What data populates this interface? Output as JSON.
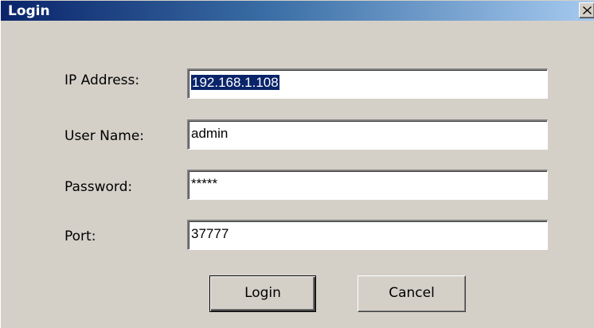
{
  "window": {
    "title": "Login",
    "close_label": "×"
  },
  "form": {
    "ip_label": "IP Address:",
    "ip_value": "192.168.1.108",
    "user_label": "User Name:",
    "user_value": "admin",
    "password_label": "Password:",
    "password_value": "*****",
    "port_label": "Port:",
    "port_value": "37777"
  },
  "buttons": {
    "login": "Login",
    "cancel": "Cancel"
  },
  "colors": {
    "titlebar_start": "#0a246a",
    "titlebar_end": "#a6caf0",
    "dialog_bg": "#d4d0c8",
    "selection": "#0a246a"
  },
  "icons": {
    "close": "close-icon"
  }
}
